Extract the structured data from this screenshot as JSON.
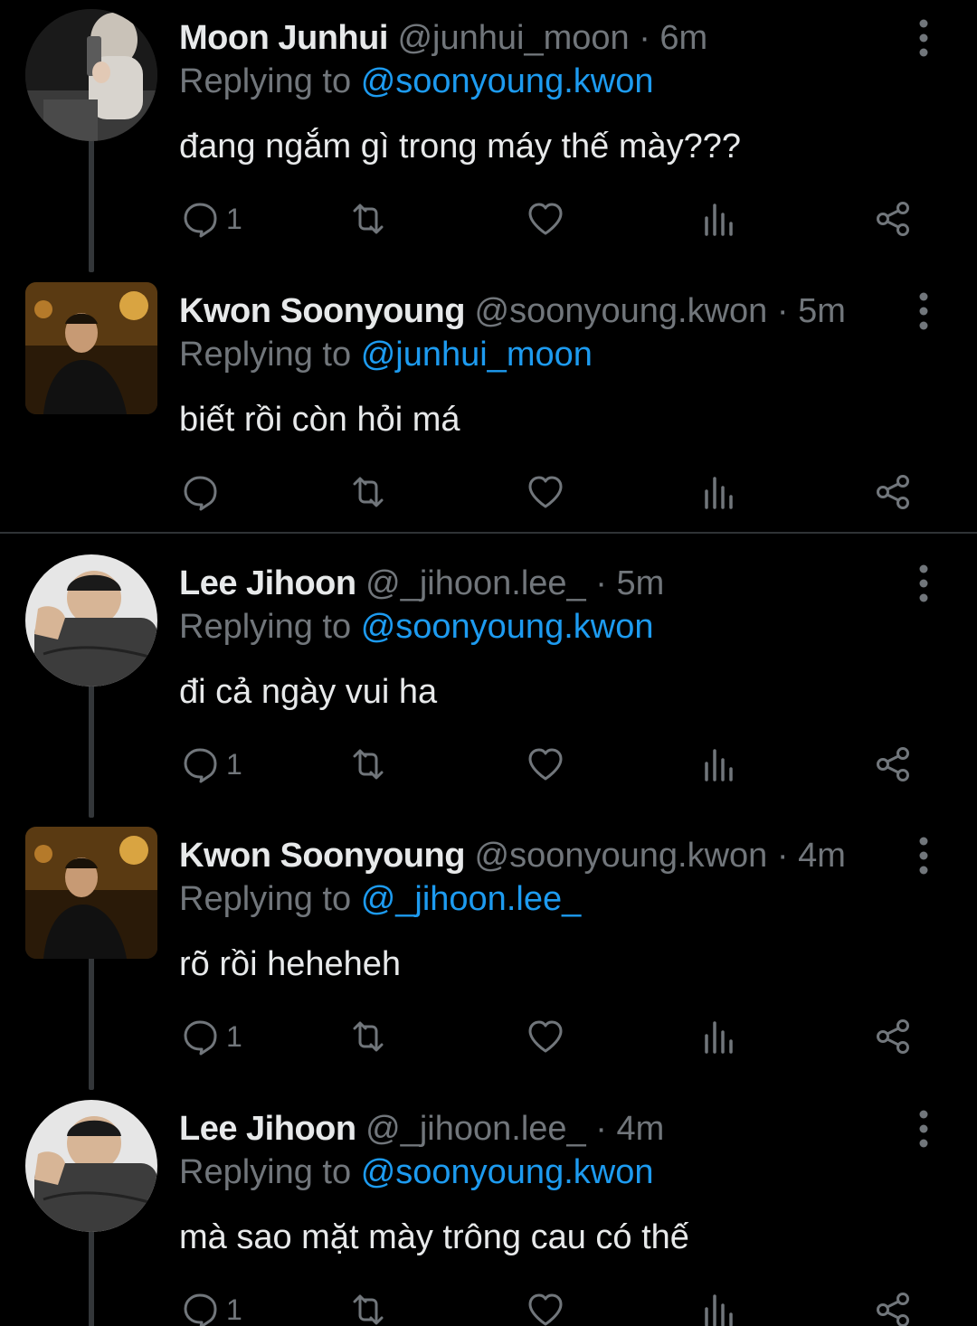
{
  "colors": {
    "background": "#000000",
    "primary_text": "#e7e9ea",
    "secondary_text": "#71767b",
    "link": "#1d9bf0",
    "thread_line": "#333639"
  },
  "tweets": [
    {
      "display_name": "Moon Junhui",
      "handle": "@junhui_moon",
      "time": "6m",
      "reply_prefix": "Replying to",
      "reply_to": "@soonyoung.kwon",
      "text": "đang ngắm gì trong máy thế mày???",
      "reply_count": "1",
      "avatar": "avatar-mirror-selfie"
    },
    {
      "display_name": "Kwon Soonyoung",
      "handle": "@soonyoung.kwon",
      "time": "5m",
      "reply_prefix": "Replying to",
      "reply_to": "@junhui_moon",
      "text": "biết rồi còn hỏi má",
      "reply_count": "",
      "avatar": "avatar-night-photo"
    },
    {
      "display_name": "Lee Jihoon",
      "handle": "@_jihoon.lee_",
      "time": "5m",
      "reply_prefix": "Replying to",
      "reply_to": "@soonyoung.kwon",
      "text": "đi cả ngày vui ha",
      "reply_count": "1",
      "avatar": "avatar-hoodie-selfie"
    },
    {
      "display_name": "Kwon Soonyoung",
      "handle": "@soonyoung.kwon",
      "time": "4m",
      "reply_prefix": "Replying to",
      "reply_to": "@_jihoon.lee_",
      "text": "rõ rồi heheheh",
      "reply_count": "1",
      "avatar": "avatar-night-photo"
    },
    {
      "display_name": "Lee Jihoon",
      "handle": "@_jihoon.lee_",
      "time": "4m",
      "reply_prefix": "Replying to",
      "reply_to": "@soonyoung.kwon",
      "text": "mà sao mặt mày trông cau có thế",
      "reply_count": "1",
      "avatar": "avatar-hoodie-selfie"
    }
  ],
  "icons": {
    "more": "more-vertical-icon",
    "reply": "reply-bubble-icon",
    "retweet": "retweet-icon",
    "like": "heart-icon",
    "views": "views-chart-icon",
    "share": "share-icon"
  }
}
